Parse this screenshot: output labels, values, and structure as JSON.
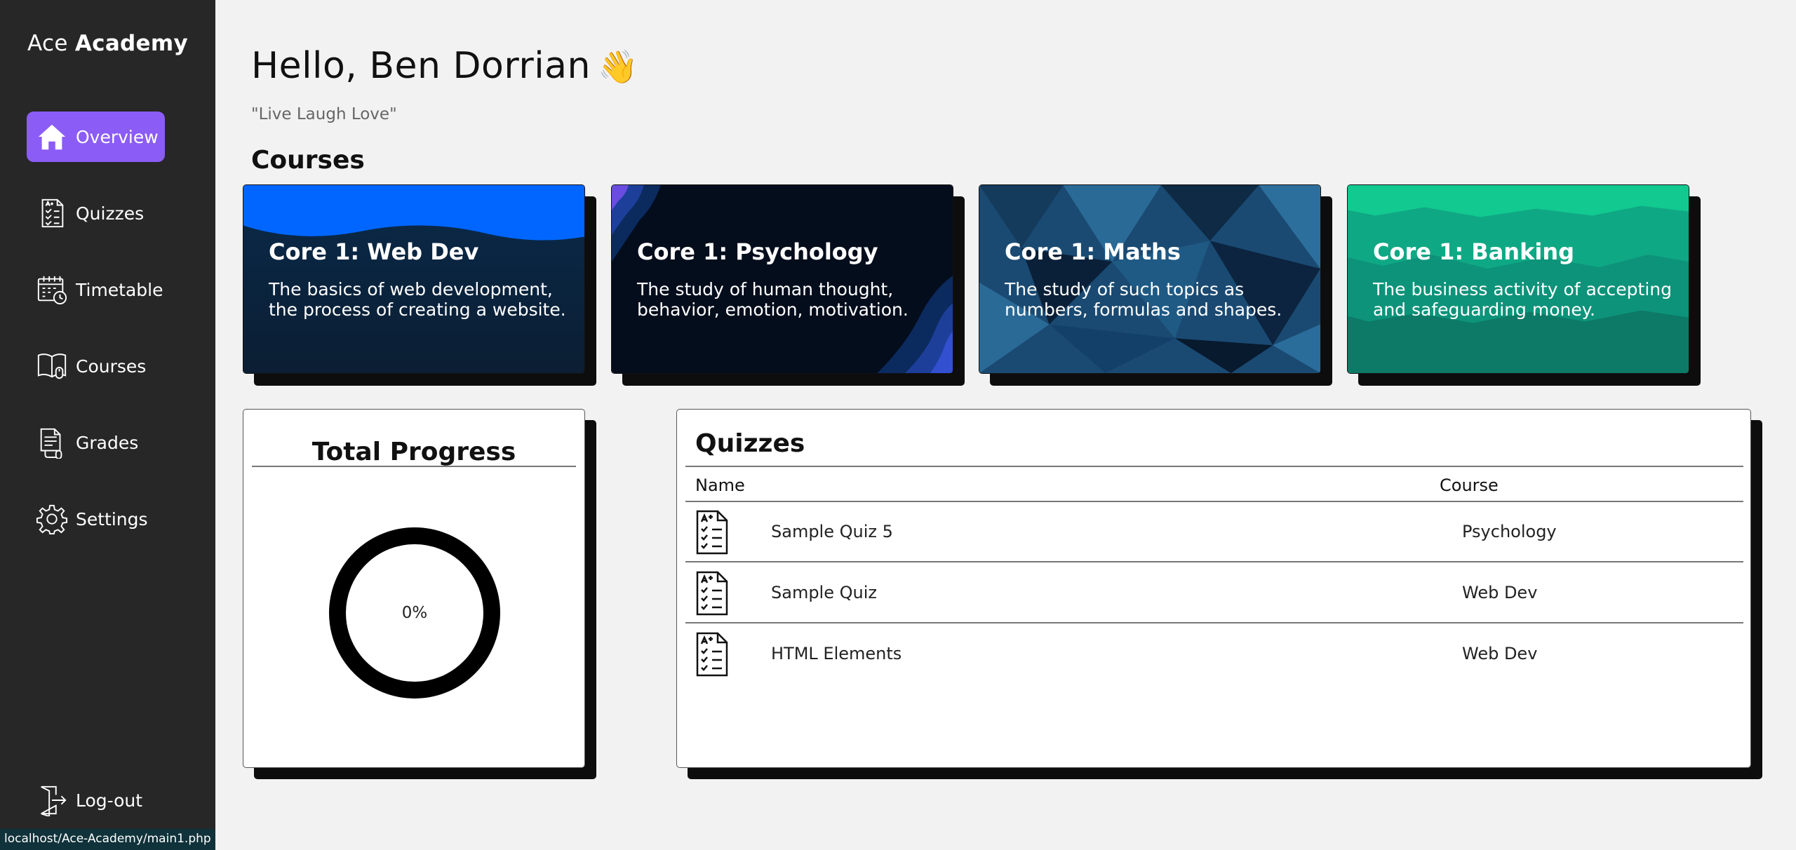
{
  "brand": {
    "light": "Ace ",
    "bold": "Academy"
  },
  "nav": [
    {
      "label": "Overview",
      "icon": "home-icon",
      "active": true
    },
    {
      "label": "Quizzes",
      "icon": "quiz-list-icon"
    },
    {
      "label": "Timetable",
      "icon": "calendar-clock-icon"
    },
    {
      "label": "Courses",
      "icon": "book-icon"
    },
    {
      "label": "Grades",
      "icon": "document-icon"
    },
    {
      "label": "Settings",
      "icon": "gear-icon"
    }
  ],
  "logout_label": "Log-out",
  "status_url": "localhost/Ace-Academy/main1.php",
  "greeting": "Hello, Ben Dorrian",
  "greeting_emoji": "👋",
  "quote": "\"Live Laugh Love\"",
  "courses_heading": "Courses",
  "courses": [
    {
      "title": "Core 1: Web Dev",
      "description": "The basics of web development, the process of creating a website."
    },
    {
      "title": "Core 1: Psychology",
      "description": "The study of human thought, behavior, emotion, motivation."
    },
    {
      "title": "Core 1: Maths",
      "description": "The study of such topics as numbers, formulas and shapes."
    },
    {
      "title": "Core 1: Banking",
      "description": "The business activity of accepting and safeguarding money."
    }
  ],
  "progress": {
    "title": "Total Progress",
    "value_label": "0%",
    "value": 0
  },
  "quizzes": {
    "title": "Quizzes",
    "col_name": "Name",
    "col_course": "Course",
    "rows": [
      {
        "name": "Sample Quiz 5",
        "course": "Psychology"
      },
      {
        "name": "Sample Quiz",
        "course": "Web Dev"
      },
      {
        "name": "HTML Elements",
        "course": "Web Dev"
      }
    ]
  },
  "colors": {
    "sidebar": "#272727",
    "accent": "#8b5cf6",
    "background": "#f2f2f2"
  }
}
